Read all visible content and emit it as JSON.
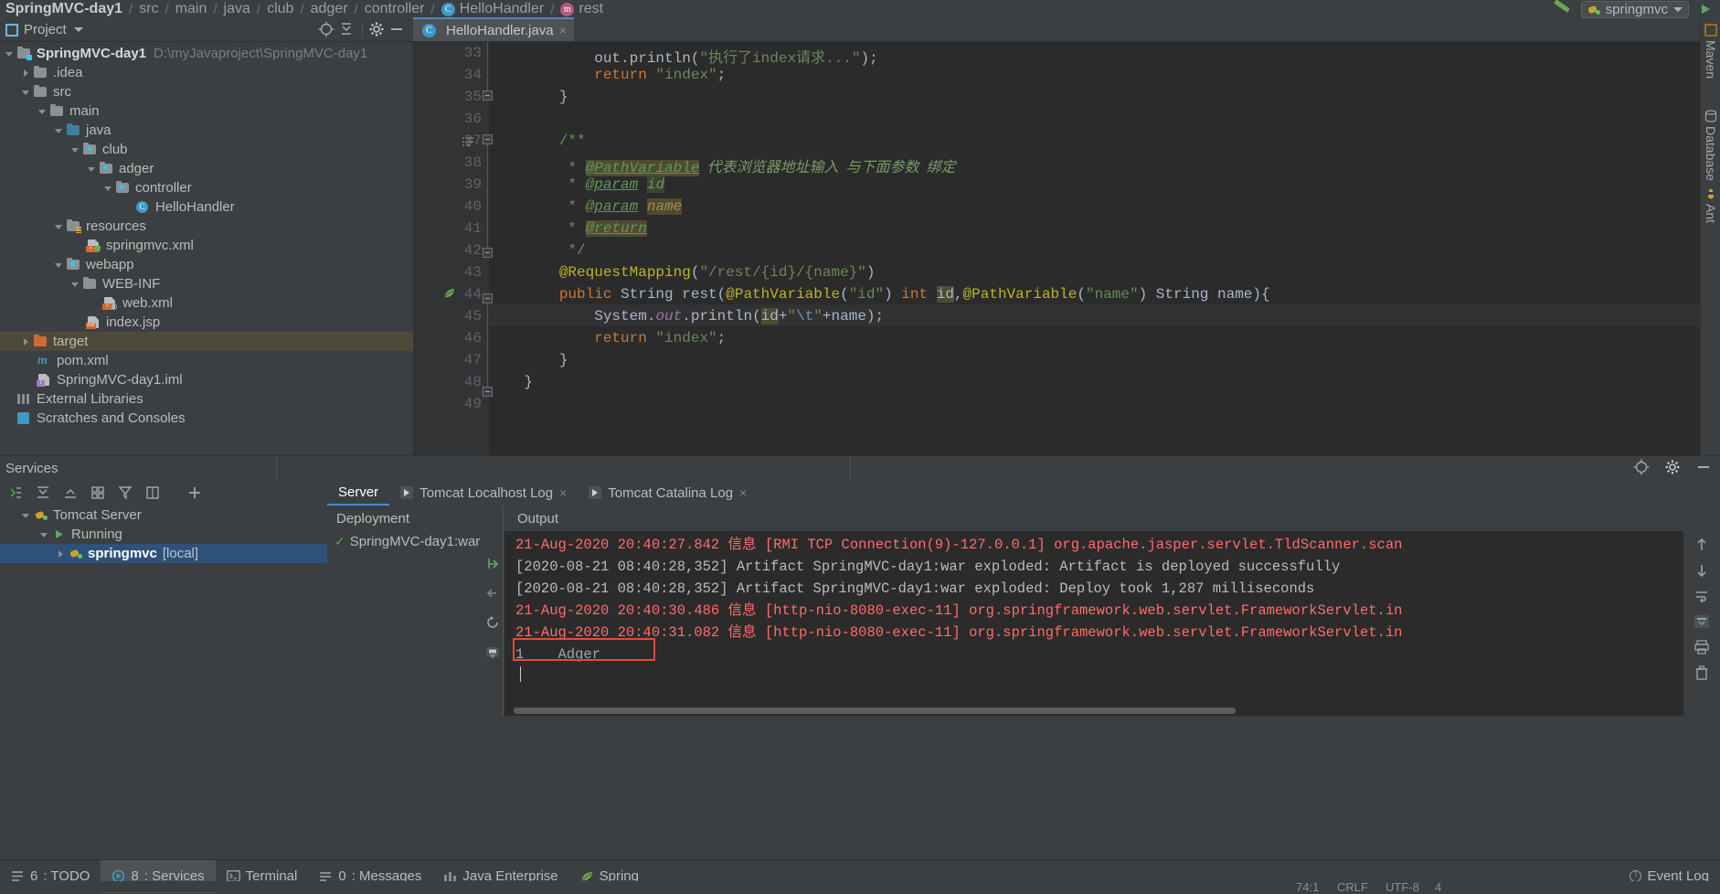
{
  "breadcrumb": {
    "items": [
      {
        "label": "SpringMVC-day1",
        "icon": "",
        "bold": true
      },
      {
        "label": "src",
        "icon": ""
      },
      {
        "label": "main",
        "icon": ""
      },
      {
        "label": "java",
        "icon": ""
      },
      {
        "label": "club",
        "icon": ""
      },
      {
        "label": "adger",
        "icon": ""
      },
      {
        "label": "controller",
        "icon": ""
      },
      {
        "label": "HelloHandler",
        "icon": "class-icon"
      },
      {
        "label": "rest",
        "icon": "method-icon"
      }
    ]
  },
  "toolbar_right": {
    "run_config": "springmvc",
    "icons": [
      "green-slash-icon",
      "bug-icon",
      "chevron-down-icon"
    ]
  },
  "project_panel": {
    "title": "Project",
    "header_icons": [
      "locate-icon",
      "collapse-all-icon",
      "settings-gear-icon",
      "hide-icon"
    ],
    "tree": [
      {
        "depth": 0,
        "arrow": "down",
        "icon": "module-folder",
        "label": "SpringMVC-day1",
        "path": "D:\\myJavaproject\\SpringMVC-day1",
        "bold": true
      },
      {
        "depth": 1,
        "arrow": "right",
        "icon": "folder",
        "label": ".idea"
      },
      {
        "depth": 1,
        "arrow": "down",
        "icon": "folder",
        "label": "src"
      },
      {
        "depth": 2,
        "arrow": "down",
        "icon": "folder",
        "label": "main"
      },
      {
        "depth": 3,
        "arrow": "down",
        "icon": "folder-blue",
        "label": "java"
      },
      {
        "depth": 4,
        "arrow": "down",
        "icon": "package",
        "label": "club"
      },
      {
        "depth": 5,
        "arrow": "down",
        "icon": "package",
        "label": "adger"
      },
      {
        "depth": 6,
        "arrow": "down",
        "icon": "package",
        "label": "controller"
      },
      {
        "depth": 7,
        "arrow": "none",
        "icon": "class",
        "label": "HelloHandler"
      },
      {
        "depth": 3,
        "arrow": "down",
        "icon": "folder-resources",
        "label": "resources"
      },
      {
        "depth": 4,
        "arrow": "none",
        "icon": "xml-spring",
        "label": "springmvc.xml"
      },
      {
        "depth": 3,
        "arrow": "down",
        "icon": "folder-web",
        "label": "webapp"
      },
      {
        "depth": 4,
        "arrow": "down",
        "icon": "folder",
        "label": "WEB-INF"
      },
      {
        "depth": 5,
        "arrow": "none",
        "icon": "xml-web",
        "label": "web.xml"
      },
      {
        "depth": 4,
        "arrow": "none",
        "icon": "jsp",
        "label": "index.jsp"
      },
      {
        "depth": 1,
        "arrow": "right",
        "icon": "folder-orange",
        "label": "target",
        "selected": true
      },
      {
        "depth": 1,
        "arrow": "none",
        "icon": "maven",
        "label": "pom.xml"
      },
      {
        "depth": 1,
        "arrow": "none",
        "icon": "iml",
        "label": "SpringMVC-day1.iml"
      },
      {
        "depth": 0,
        "arrow": "none",
        "icon": "libraries",
        "label": "External Libraries"
      },
      {
        "depth": 0,
        "arrow": "none",
        "icon": "scratches",
        "label": "Scratches and Consoles"
      }
    ]
  },
  "editor": {
    "tab": {
      "label": "HelloHandler.java",
      "icon": "class-icon",
      "close": "×"
    },
    "first_line_number": 33,
    "lines": [
      {
        "n": 33,
        "segments": [
          {
            "t": "            out.",
            "c": "typ"
          },
          {
            "t": "println",
            "c": "typ"
          },
          {
            "t": "(",
            "c": "typ"
          },
          {
            "t": "\"执行了index请求...\"",
            "c": "str"
          },
          {
            "t": ");",
            "c": "typ"
          }
        ]
      },
      {
        "n": 34,
        "segments": [
          {
            "t": "            ",
            "c": "typ"
          },
          {
            "t": "return",
            "c": "kw"
          },
          {
            "t": " ",
            "c": "typ"
          },
          {
            "t": "\"index\"",
            "c": "str"
          },
          {
            "t": ";",
            "c": "typ"
          }
        ]
      },
      {
        "n": 35,
        "segments": [
          {
            "t": "        }",
            "c": "typ"
          }
        ]
      },
      {
        "n": 36,
        "segments": []
      },
      {
        "n": 37,
        "segments": [
          {
            "t": "        /**",
            "c": "cmt"
          }
        ]
      },
      {
        "n": 38,
        "segments": [
          {
            "t": "         * ",
            "c": "cmt"
          },
          {
            "t": "@PathVariable",
            "c": "doctag-hl"
          },
          {
            "t": "  代表浏览器地址输入  与下面参数  绑定",
            "c": "zh"
          }
        ]
      },
      {
        "n": 39,
        "segments": [
          {
            "t": "         * ",
            "c": "cmt"
          },
          {
            "t": "@param",
            "c": "doctag"
          },
          {
            "t": " ",
            "c": "cmt"
          },
          {
            "t": "id",
            "c": "docparam"
          }
        ]
      },
      {
        "n": 40,
        "segments": [
          {
            "t": "         * ",
            "c": "cmt"
          },
          {
            "t": "@param",
            "c": "doctag"
          },
          {
            "t": " ",
            "c": "cmt"
          },
          {
            "t": "name",
            "c": "docparam-hl"
          }
        ]
      },
      {
        "n": 41,
        "segments": [
          {
            "t": "         * ",
            "c": "cmt"
          },
          {
            "t": "@return",
            "c": "doctag-hl"
          }
        ]
      },
      {
        "n": 42,
        "segments": [
          {
            "t": "         */",
            "c": "cmt"
          }
        ]
      },
      {
        "n": 43,
        "segments": [
          {
            "t": "        ",
            "c": "typ"
          },
          {
            "t": "@RequestMapping",
            "c": "ann"
          },
          {
            "t": "(",
            "c": "typ"
          },
          {
            "t": "\"/rest/{id}/{name}\"",
            "c": "str"
          },
          {
            "t": ")",
            "c": "typ"
          }
        ]
      },
      {
        "n": 44,
        "segments": [
          {
            "t": "        ",
            "c": "typ"
          },
          {
            "t": "public",
            "c": "kw"
          },
          {
            "t": " String ",
            "c": "typ"
          },
          {
            "t": "rest",
            "c": "typ"
          },
          {
            "t": "(",
            "c": "typ"
          },
          {
            "t": "@PathVariable",
            "c": "ann"
          },
          {
            "t": "(",
            "c": "typ"
          },
          {
            "t": "\"id\"",
            "c": "str"
          },
          {
            "t": ") ",
            "c": "typ"
          },
          {
            "t": "int",
            "c": "kw"
          },
          {
            "t": " ",
            "c": "typ"
          },
          {
            "t": "id",
            "c": "hlvar"
          },
          {
            "t": ",",
            "c": "typ"
          },
          {
            "t": "@PathVariable",
            "c": "ann"
          },
          {
            "t": "(",
            "c": "typ"
          },
          {
            "t": "\"name\"",
            "c": "str"
          },
          {
            "t": ") String name){",
            "c": "typ"
          }
        ]
      },
      {
        "n": 45,
        "segments": [
          {
            "t": "            System.",
            "c": "typ"
          },
          {
            "t": "out",
            "c": "fld"
          },
          {
            "t": ".println(",
            "c": "typ"
          },
          {
            "t": "id",
            "c": "hlvar"
          },
          {
            "t": "+",
            "c": "typ"
          },
          {
            "t": "\"",
            "c": "str"
          },
          {
            "t": "\\t",
            "c": "esc"
          },
          {
            "t": "\"",
            "c": "str"
          },
          {
            "t": "+name);",
            "c": "typ"
          }
        ]
      },
      {
        "n": 46,
        "segments": [
          {
            "t": "            ",
            "c": "typ"
          },
          {
            "t": "return",
            "c": "kw"
          },
          {
            "t": " ",
            "c": "typ"
          },
          {
            "t": "\"index\"",
            "c": "str"
          },
          {
            "t": ";",
            "c": "typ"
          }
        ]
      },
      {
        "n": 47,
        "segments": [
          {
            "t": "        }",
            "c": "typ"
          }
        ]
      },
      {
        "n": 48,
        "segments": [
          {
            "t": "    }",
            "c": "typ"
          }
        ]
      },
      {
        "n": 49,
        "segments": []
      }
    ],
    "highlighted_line": 45
  },
  "right_strip": {
    "items": [
      "Maven",
      "Database",
      "Ant"
    ]
  },
  "services": {
    "title": "Services",
    "header_icons": [
      "locate-icon",
      "settings-gear-icon",
      "hide-icon"
    ],
    "toolbar_icons": [
      "expand-icon",
      "collapse-icon",
      "group-icon",
      "filter-icon",
      "layout-icon",
      "add-icon"
    ],
    "tree": [
      {
        "depth": 0,
        "arrow": "down",
        "icon": "tomcat-icon",
        "label": "Tomcat Server"
      },
      {
        "depth": 1,
        "arrow": "down",
        "icon": "run-icon",
        "label": "Running"
      },
      {
        "depth": 2,
        "arrow": "right",
        "icon": "tomcat-icon",
        "label": "springmvc",
        "suffix": "[local]",
        "selected": true
      }
    ],
    "run_tabs": [
      {
        "label": "Server",
        "active": true,
        "closable": false,
        "icon": ""
      },
      {
        "label": "Tomcat Localhost Log",
        "active": false,
        "closable": true,
        "icon": "play-icon"
      },
      {
        "label": "Tomcat Catalina Log",
        "active": false,
        "closable": true,
        "icon": "play-icon"
      }
    ],
    "deployment": {
      "header": "Deployment",
      "items": [
        {
          "label": "SpringMVC-day1:war ",
          "status": "deployed"
        }
      ]
    },
    "output": {
      "header": "Output",
      "lines": [
        {
          "text": "21-Aug-2020 20:40:27.842 信息 [RMI TCP Connection(9)-127.0.0.1] org.apache.jasper.servlet.TldScanner.scan",
          "color": "red"
        },
        {
          "text": "[2020-08-21 08:40:28,352] Artifact SpringMVC-day1:war exploded: Artifact is deployed successfully",
          "color": "grey"
        },
        {
          "text": "[2020-08-21 08:40:28,352] Artifact SpringMVC-day1:war exploded: Deploy took 1,287 milliseconds",
          "color": "grey"
        },
        {
          "text": "21-Aug-2020 20:40:30.486 信息 [http-nio-8080-exec-11] org.springframework.web.servlet.FrameworkServlet.in",
          "color": "red"
        },
        {
          "text": "21-Aug-2020 20:40:31.082 信息 [http-nio-8080-exec-11] org.springframework.web.servlet.FrameworkServlet.in",
          "color": "red"
        },
        {
          "text": "1    Adger",
          "color": "grey",
          "boxed": true
        }
      ],
      "highlight_box_color": "#e04a3f"
    }
  },
  "statusbar": {
    "left_items": [
      {
        "key": "6",
        "label": ": TODO",
        "icon": "todo-icon"
      },
      {
        "key": "8",
        "label": ": Services",
        "icon": "services-icon",
        "active": true
      },
      {
        "key": "",
        "label": "Terminal",
        "icon": "terminal-icon"
      },
      {
        "key": "0",
        "label": ": Messages",
        "icon": "messages-icon"
      },
      {
        "key": "",
        "label": "Java Enterprise",
        "icon": "java-enterprise-icon"
      },
      {
        "key": "",
        "label": "Spring",
        "icon": "spring-icon"
      }
    ],
    "right_items": [
      {
        "label": "Event Log",
        "icon": "event-log-icon"
      }
    ],
    "caret_info": "74:1",
    "line_sep": "CRLF",
    "encoding": "UTF-8",
    "indent": "4"
  }
}
